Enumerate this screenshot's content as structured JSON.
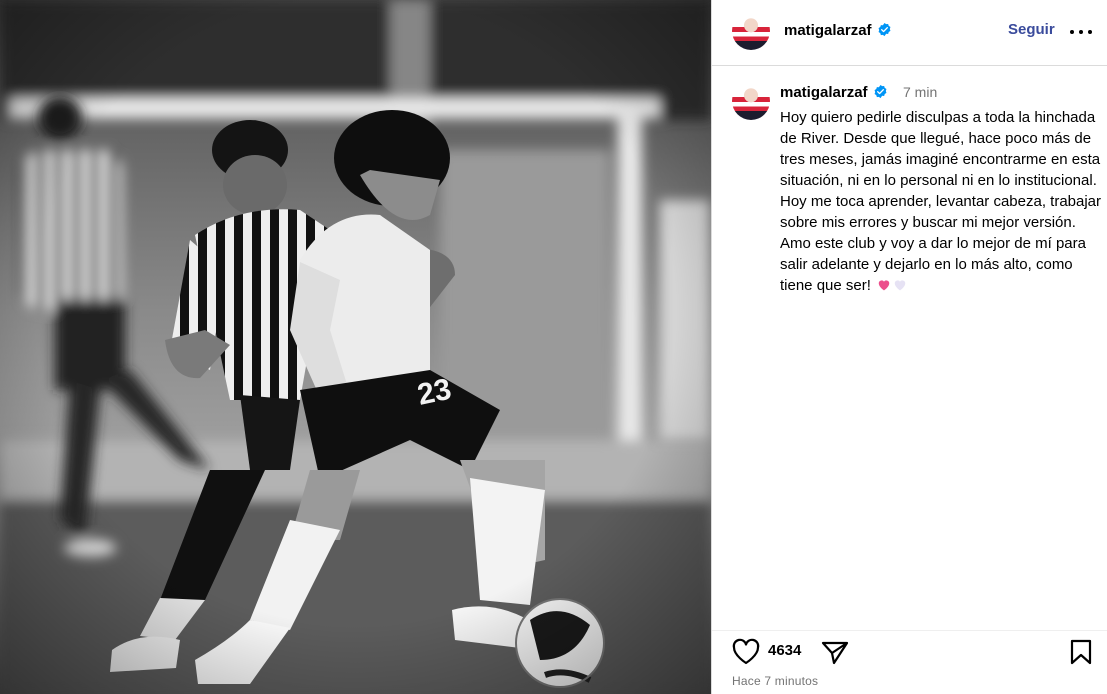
{
  "post": {
    "header": {
      "username": "matigalarzaf",
      "follow_label": "Seguir",
      "more_icon": "more-options-icon"
    },
    "caption": {
      "username": "matigalarzaf",
      "time": "7 min",
      "text": "Hoy quiero pedirle disculpas a toda la hinchada de River. Desde que llegué, hace poco más de tres meses, jamás imaginé encontrarme en esta situación, ni en lo personal ni en lo institucional. Hoy me toca aprender, levantar cabeza, trabajar sobre mis errores y buscar mi mejor versión. Amo este club y voy a dar lo mejor de mí para salir adelante y dejarlo en lo más alto, como tiene que ser!"
    },
    "actions": {
      "likes": "4634",
      "icons": [
        "heart-icon",
        "share-icon",
        "bookmark-icon"
      ]
    },
    "date": "Hace 7 minutos",
    "colors": {
      "follow": "#3a4b9c",
      "verified": "#0095f6",
      "secondary_text": "#737373",
      "pink_heart": "#ec4f8c",
      "white_heart": "#e6e2f4"
    }
  }
}
